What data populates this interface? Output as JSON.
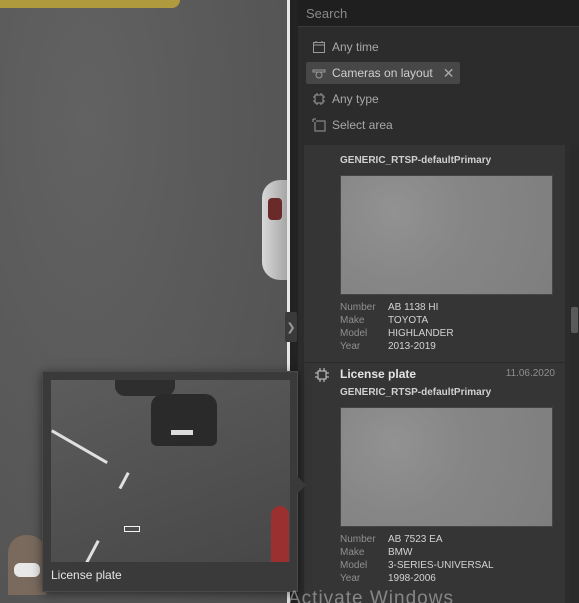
{
  "search": {
    "placeholder": "Search"
  },
  "filters": [
    {
      "label": "Any time",
      "icon": "calendar-icon",
      "active": false
    },
    {
      "label": "Cameras on layout",
      "icon": "camera-icon",
      "active": true
    },
    {
      "label": "Any type",
      "icon": "chip-icon",
      "active": false
    },
    {
      "label": "Select area",
      "icon": "area-icon",
      "active": false
    }
  ],
  "results": [
    {
      "title": "",
      "date": "",
      "camera": "GENERIC_RTSP-defaultPrimary",
      "meta": [
        {
          "k": "Number",
          "v": "AB 1138 HI"
        },
        {
          "k": "Make",
          "v": "TOYOTA"
        },
        {
          "k": "Model",
          "v": "HIGHLANDER"
        },
        {
          "k": "Year",
          "v": "2013-2019"
        }
      ]
    },
    {
      "title": "License plate",
      "date": "11.06.2020",
      "camera": "GENERIC_RTSP-defaultPrimary",
      "meta": [
        {
          "k": "Number",
          "v": "AB 7523 EA"
        },
        {
          "k": "Make",
          "v": "BMW"
        },
        {
          "k": "Model",
          "v": "3-SERIES-UNIVERSAL"
        },
        {
          "k": "Year",
          "v": "1998-2006"
        }
      ]
    }
  ],
  "popover": {
    "caption": "License plate"
  },
  "watermark": "Activate Windows",
  "colors": {
    "panel": "#2c2c2c",
    "card": "#353535",
    "accent": "#474747"
  }
}
